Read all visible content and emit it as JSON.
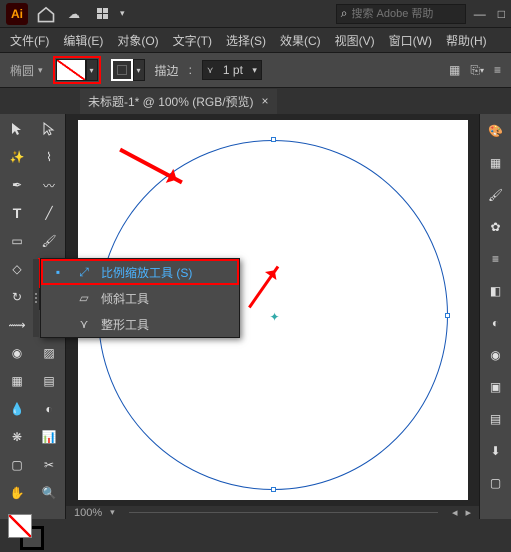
{
  "titlebar": {
    "app": "Ai",
    "search_placeholder": "搜索 Adobe 帮助"
  },
  "menu": {
    "file": "文件(F)",
    "edit": "编辑(E)",
    "object": "对象(O)",
    "type": "文字(T)",
    "select": "选择(S)",
    "effect": "效果(C)",
    "view": "视图(V)",
    "window": "窗口(W)",
    "help": "帮助(H)"
  },
  "control": {
    "shape": "椭圆",
    "stroke_label": "描边",
    "stroke_value": "1 pt"
  },
  "tab": {
    "title": "未标题-1* @ 100% (RGB/预览)",
    "close": "×"
  },
  "flyout": {
    "scale": "比例缩放工具  (S)",
    "shear": "倾斜工具",
    "reshape": "整形工具"
  },
  "status": {
    "zoom": "100%"
  }
}
